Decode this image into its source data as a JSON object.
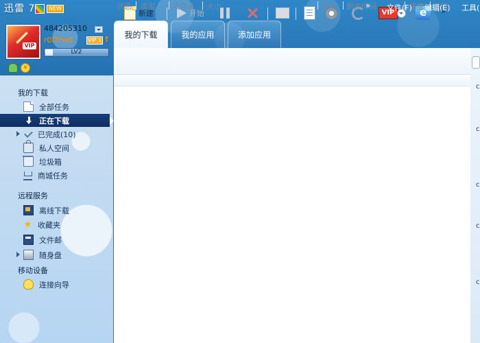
{
  "app": {
    "title": "迅雷 7",
    "badge": "NEW",
    "menu": {
      "more": "»",
      "items": [
        "文件(F)",
        "编辑(E)",
        "工具("
      ]
    }
  },
  "user": {
    "id": "484205310",
    "name": "r0DYwB",
    "vip_badge": "VIP 1",
    "level": "LV2",
    "level_progress": 0.12
  },
  "sidebar": {
    "sections": [
      {
        "title": "我的下载",
        "items": [
          {
            "label": "全部任务",
            "icon": "document-icon"
          },
          {
            "label": "正在下载",
            "icon": "down-arrow-icon",
            "active": true
          },
          {
            "label": "已完成(10)",
            "icon": "check-icon",
            "expander": true
          },
          {
            "label": "私人空间",
            "icon": "lock-icon"
          },
          {
            "label": "垃圾箱",
            "icon": "trash-icon"
          },
          {
            "label": "商城任务",
            "icon": "cart-icon"
          }
        ]
      },
      {
        "title": "远程服务",
        "items": [
          {
            "label": "离线下载",
            "icon": "monitor-icon"
          },
          {
            "label": "收藏夹",
            "icon": "star-icon"
          },
          {
            "label": "文件邮",
            "icon": "mailbox-icon"
          },
          {
            "label": "随身盘",
            "icon": "disk-icon",
            "expander": true
          }
        ]
      },
      {
        "title": "移动设备",
        "items": [
          {
            "label": "连接向导",
            "icon": "bulb-icon"
          }
        ]
      }
    ]
  },
  "tabs": [
    {
      "label": "我的下载",
      "active": true
    },
    {
      "label": "我的应用",
      "active": false
    },
    {
      "label": "添加应用",
      "active": false
    }
  ],
  "toolbar": {
    "new_label": "新建",
    "start_label": "开始",
    "more": "»"
  },
  "columns": [
    "状态",
    "类型",
    "文件名",
    "大小",
    "进度",
    "剩余时间",
    "速度",
    "热度"
  ],
  "right_edge_char": "c"
}
